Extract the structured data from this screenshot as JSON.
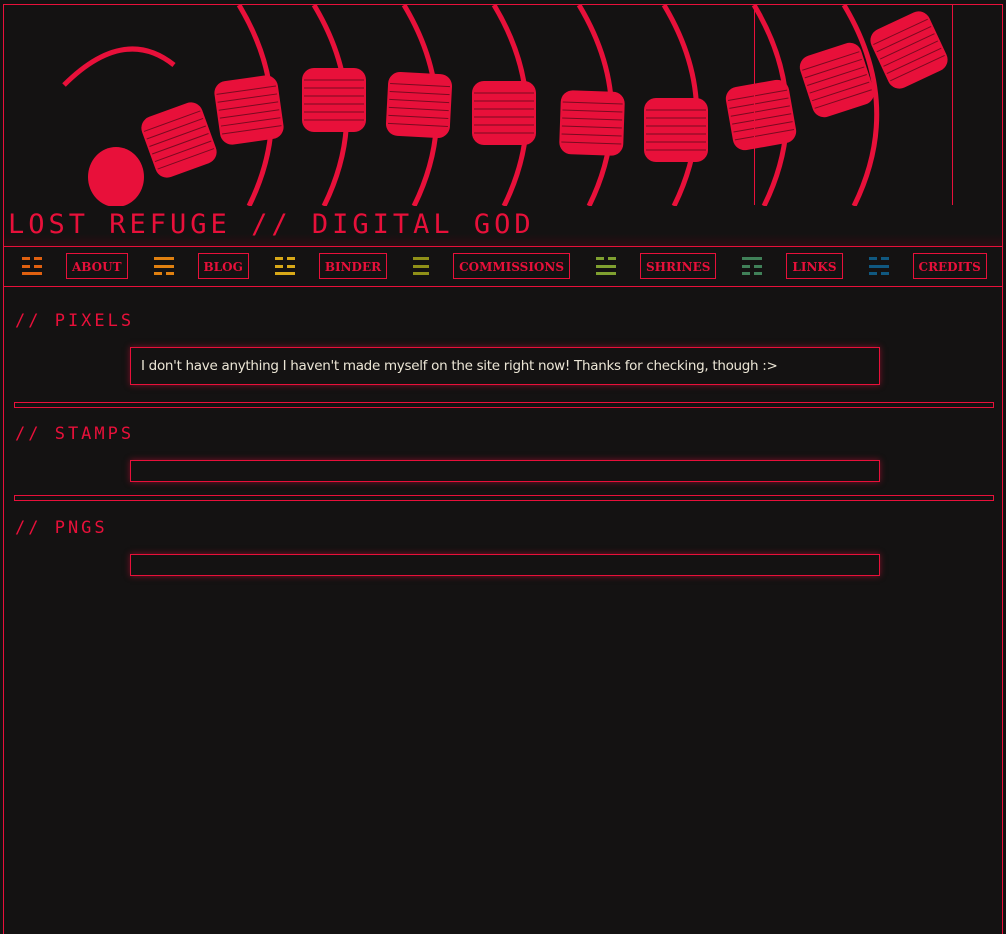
{
  "site": {
    "title": "LOST REFUGE // DIGITAL GOD"
  },
  "colors": {
    "accent": "#e8103a",
    "background": "#141212",
    "text": "#ece6d6"
  },
  "nav": {
    "items": [
      {
        "label": "ABOUT"
      },
      {
        "label": "BLOG"
      },
      {
        "label": "BINDER"
      },
      {
        "label": "COMMISSIONS"
      },
      {
        "label": "SHRINES"
      },
      {
        "label": "LINKS"
      },
      {
        "label": "CREDITS"
      }
    ],
    "trigrams": [
      {
        "icon": "trigram-icon",
        "color": "#e06010",
        "lines": [
          0,
          0,
          1
        ]
      },
      {
        "icon": "trigram-icon",
        "color": "#e08010",
        "lines": [
          1,
          1,
          0
        ]
      },
      {
        "icon": "trigram-icon",
        "color": "#d8a818",
        "lines": [
          0,
          0,
          1
        ]
      },
      {
        "icon": "trigram-icon",
        "color": "#909018",
        "lines": [
          0,
          0,
          0
        ]
      },
      {
        "icon": "trigram-icon",
        "color": "#80a030",
        "lines": [
          0,
          1,
          1
        ]
      },
      {
        "icon": "trigram-icon",
        "color": "#408058",
        "lines": [
          1,
          0,
          0
        ]
      },
      {
        "icon": "trigram-icon",
        "color": "#105880",
        "lines": [
          0,
          1,
          0
        ]
      },
      {
        "icon": "trigram-icon",
        "color": "#505070",
        "lines": [
          1,
          1,
          1
        ]
      }
    ]
  },
  "sections": [
    {
      "heading": "// PIXELS",
      "text": "I don't have anything I haven't made myself on the site right now! Thanks for checking, though :>"
    },
    {
      "heading": "// STAMPS",
      "text": ""
    },
    {
      "heading": "// PNGS",
      "text": ""
    }
  ]
}
